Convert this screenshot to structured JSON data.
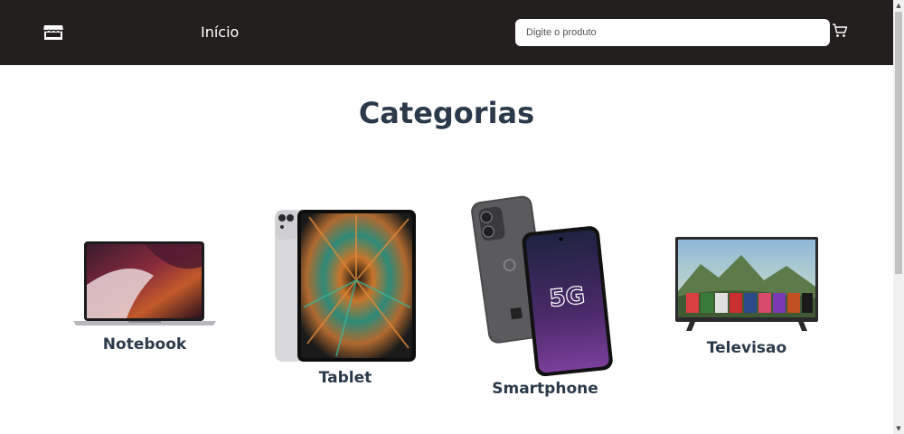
{
  "navbar": {
    "logo_icon": "store-icon",
    "home_link": "Início",
    "search": {
      "placeholder": "Digite o produto",
      "value": ""
    },
    "cart_icon": "cart-icon",
    "background": "#231f1e"
  },
  "main": {
    "title": "Categorias",
    "categories": [
      {
        "label": "Notebook",
        "image": "laptop-image"
      },
      {
        "label": "Tablet",
        "image": "tablet-image"
      },
      {
        "label": "Smartphone",
        "image": "smartphone-image"
      },
      {
        "label": "Televisao",
        "image": "television-image"
      }
    ],
    "title_color": "#2b3a4a"
  },
  "images": {
    "smartphone_screen_text": "5G"
  }
}
